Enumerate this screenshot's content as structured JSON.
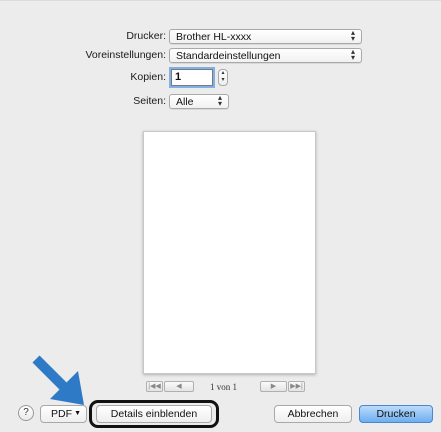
{
  "form": {
    "printer": {
      "label": "Drucker:",
      "value": "Brother HL-xxxx"
    },
    "presets": {
      "label": "Voreinstellungen:",
      "value": "Standardeinstellungen"
    },
    "copies": {
      "label": "Kopien:",
      "value": "1"
    },
    "pages": {
      "label": "Seiten:",
      "value": "Alle"
    }
  },
  "preview": {
    "page_info": "1 von 1",
    "nav": {
      "first": "|◀◀",
      "prev": "◀",
      "next": "▶",
      "last": "▶▶|"
    }
  },
  "footer": {
    "help_label": "?",
    "pdf_label": "PDF",
    "details_label": "Details einblenden",
    "cancel_label": "Abbrechen",
    "print_label": "Drucken"
  },
  "colors": {
    "accent": "#6eaef0",
    "arrow": "#2e7ac6",
    "dialog_bg": "#ececec"
  }
}
